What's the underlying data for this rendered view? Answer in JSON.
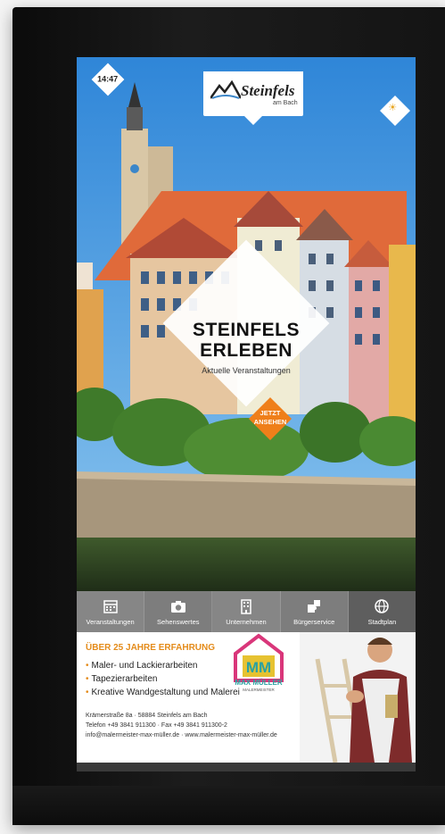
{
  "status": {
    "time": "14:47"
  },
  "brand": {
    "name": "Steinfels",
    "sub": "am Bach"
  },
  "promo": {
    "title_line1": "STEINFELS",
    "title_line2": "ERLEBEN",
    "subtitle": "Aktuelle Veranstaltungen",
    "cta_line1": "JETZT",
    "cta_line2": "ANSEHEN"
  },
  "nav": {
    "items": [
      {
        "label": "Veranstaltungen",
        "icon": "calendar-icon"
      },
      {
        "label": "Sehenswertes",
        "icon": "camera-icon"
      },
      {
        "label": "Unternehmen",
        "icon": "building-icon"
      },
      {
        "label": "Bürgerservice",
        "icon": "puzzle-icon"
      },
      {
        "label": "Stadtplan",
        "icon": "globe-icon"
      }
    ]
  },
  "ad": {
    "headline": "ÜBER 25 JAHRE ERFAHRUNG",
    "services": [
      "Maler- und Lackierarbeiten",
      "Tapezierarbeiten",
      "Kreative Wandgestaltung und Malerei"
    ],
    "address": "Krämerstraße 8a · 58884 Steinfels am Bach",
    "phone": "Telefon +49 3841 911300 · Fax +49 3841 911300-2",
    "contact": "info@malermeister-max-müller.de · www.malermeister-max-müller.de",
    "company_name": "MAX MÜLLER",
    "company_sub": "MALERMEISTER",
    "logo_letters": "MM"
  },
  "colors": {
    "accent": "#ef7f1a",
    "brand_teal": "#2aa1a1",
    "logo_pink": "#d9367a"
  }
}
